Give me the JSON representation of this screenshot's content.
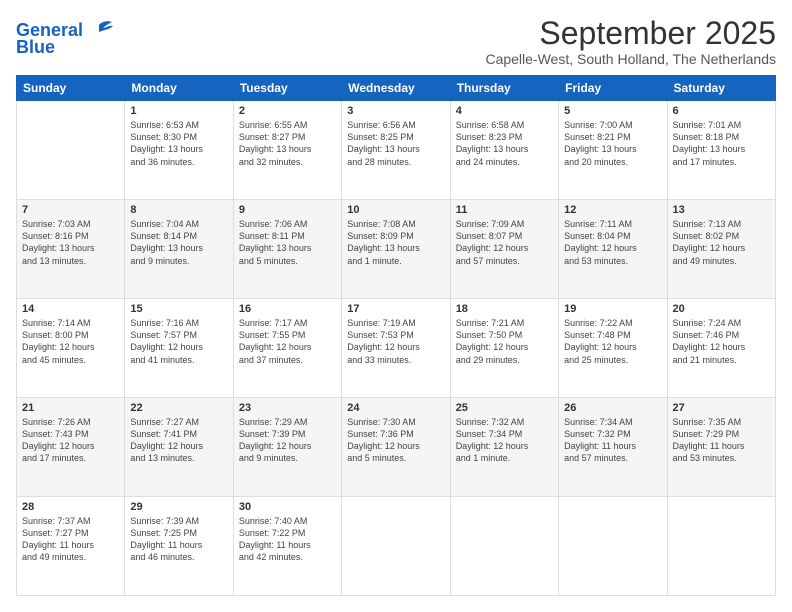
{
  "logo": {
    "line1": "General",
    "line2": "Blue"
  },
  "title": "September 2025",
  "location": "Capelle-West, South Holland, The Netherlands",
  "days_of_week": [
    "Sunday",
    "Monday",
    "Tuesday",
    "Wednesday",
    "Thursday",
    "Friday",
    "Saturday"
  ],
  "weeks": [
    [
      {
        "day": "",
        "content": ""
      },
      {
        "day": "1",
        "content": "Sunrise: 6:53 AM\nSunset: 8:30 PM\nDaylight: 13 hours\nand 36 minutes."
      },
      {
        "day": "2",
        "content": "Sunrise: 6:55 AM\nSunset: 8:27 PM\nDaylight: 13 hours\nand 32 minutes."
      },
      {
        "day": "3",
        "content": "Sunrise: 6:56 AM\nSunset: 8:25 PM\nDaylight: 13 hours\nand 28 minutes."
      },
      {
        "day": "4",
        "content": "Sunrise: 6:58 AM\nSunset: 8:23 PM\nDaylight: 13 hours\nand 24 minutes."
      },
      {
        "day": "5",
        "content": "Sunrise: 7:00 AM\nSunset: 8:21 PM\nDaylight: 13 hours\nand 20 minutes."
      },
      {
        "day": "6",
        "content": "Sunrise: 7:01 AM\nSunset: 8:18 PM\nDaylight: 13 hours\nand 17 minutes."
      }
    ],
    [
      {
        "day": "7",
        "content": "Sunrise: 7:03 AM\nSunset: 8:16 PM\nDaylight: 13 hours\nand 13 minutes."
      },
      {
        "day": "8",
        "content": "Sunrise: 7:04 AM\nSunset: 8:14 PM\nDaylight: 13 hours\nand 9 minutes."
      },
      {
        "day": "9",
        "content": "Sunrise: 7:06 AM\nSunset: 8:11 PM\nDaylight: 13 hours\nand 5 minutes."
      },
      {
        "day": "10",
        "content": "Sunrise: 7:08 AM\nSunset: 8:09 PM\nDaylight: 13 hours\nand 1 minute."
      },
      {
        "day": "11",
        "content": "Sunrise: 7:09 AM\nSunset: 8:07 PM\nDaylight: 12 hours\nand 57 minutes."
      },
      {
        "day": "12",
        "content": "Sunrise: 7:11 AM\nSunset: 8:04 PM\nDaylight: 12 hours\nand 53 minutes."
      },
      {
        "day": "13",
        "content": "Sunrise: 7:13 AM\nSunset: 8:02 PM\nDaylight: 12 hours\nand 49 minutes."
      }
    ],
    [
      {
        "day": "14",
        "content": "Sunrise: 7:14 AM\nSunset: 8:00 PM\nDaylight: 12 hours\nand 45 minutes."
      },
      {
        "day": "15",
        "content": "Sunrise: 7:16 AM\nSunset: 7:57 PM\nDaylight: 12 hours\nand 41 minutes."
      },
      {
        "day": "16",
        "content": "Sunrise: 7:17 AM\nSunset: 7:55 PM\nDaylight: 12 hours\nand 37 minutes."
      },
      {
        "day": "17",
        "content": "Sunrise: 7:19 AM\nSunset: 7:53 PM\nDaylight: 12 hours\nand 33 minutes."
      },
      {
        "day": "18",
        "content": "Sunrise: 7:21 AM\nSunset: 7:50 PM\nDaylight: 12 hours\nand 29 minutes."
      },
      {
        "day": "19",
        "content": "Sunrise: 7:22 AM\nSunset: 7:48 PM\nDaylight: 12 hours\nand 25 minutes."
      },
      {
        "day": "20",
        "content": "Sunrise: 7:24 AM\nSunset: 7:46 PM\nDaylight: 12 hours\nand 21 minutes."
      }
    ],
    [
      {
        "day": "21",
        "content": "Sunrise: 7:26 AM\nSunset: 7:43 PM\nDaylight: 12 hours\nand 17 minutes."
      },
      {
        "day": "22",
        "content": "Sunrise: 7:27 AM\nSunset: 7:41 PM\nDaylight: 12 hours\nand 13 minutes."
      },
      {
        "day": "23",
        "content": "Sunrise: 7:29 AM\nSunset: 7:39 PM\nDaylight: 12 hours\nand 9 minutes."
      },
      {
        "day": "24",
        "content": "Sunrise: 7:30 AM\nSunset: 7:36 PM\nDaylight: 12 hours\nand 5 minutes."
      },
      {
        "day": "25",
        "content": "Sunrise: 7:32 AM\nSunset: 7:34 PM\nDaylight: 12 hours\nand 1 minute."
      },
      {
        "day": "26",
        "content": "Sunrise: 7:34 AM\nSunset: 7:32 PM\nDaylight: 11 hours\nand 57 minutes."
      },
      {
        "day": "27",
        "content": "Sunrise: 7:35 AM\nSunset: 7:29 PM\nDaylight: 11 hours\nand 53 minutes."
      }
    ],
    [
      {
        "day": "28",
        "content": "Sunrise: 7:37 AM\nSunset: 7:27 PM\nDaylight: 11 hours\nand 49 minutes."
      },
      {
        "day": "29",
        "content": "Sunrise: 7:39 AM\nSunset: 7:25 PM\nDaylight: 11 hours\nand 46 minutes."
      },
      {
        "day": "30",
        "content": "Sunrise: 7:40 AM\nSunset: 7:22 PM\nDaylight: 11 hours\nand 42 minutes."
      },
      {
        "day": "",
        "content": ""
      },
      {
        "day": "",
        "content": ""
      },
      {
        "day": "",
        "content": ""
      },
      {
        "day": "",
        "content": ""
      }
    ]
  ]
}
